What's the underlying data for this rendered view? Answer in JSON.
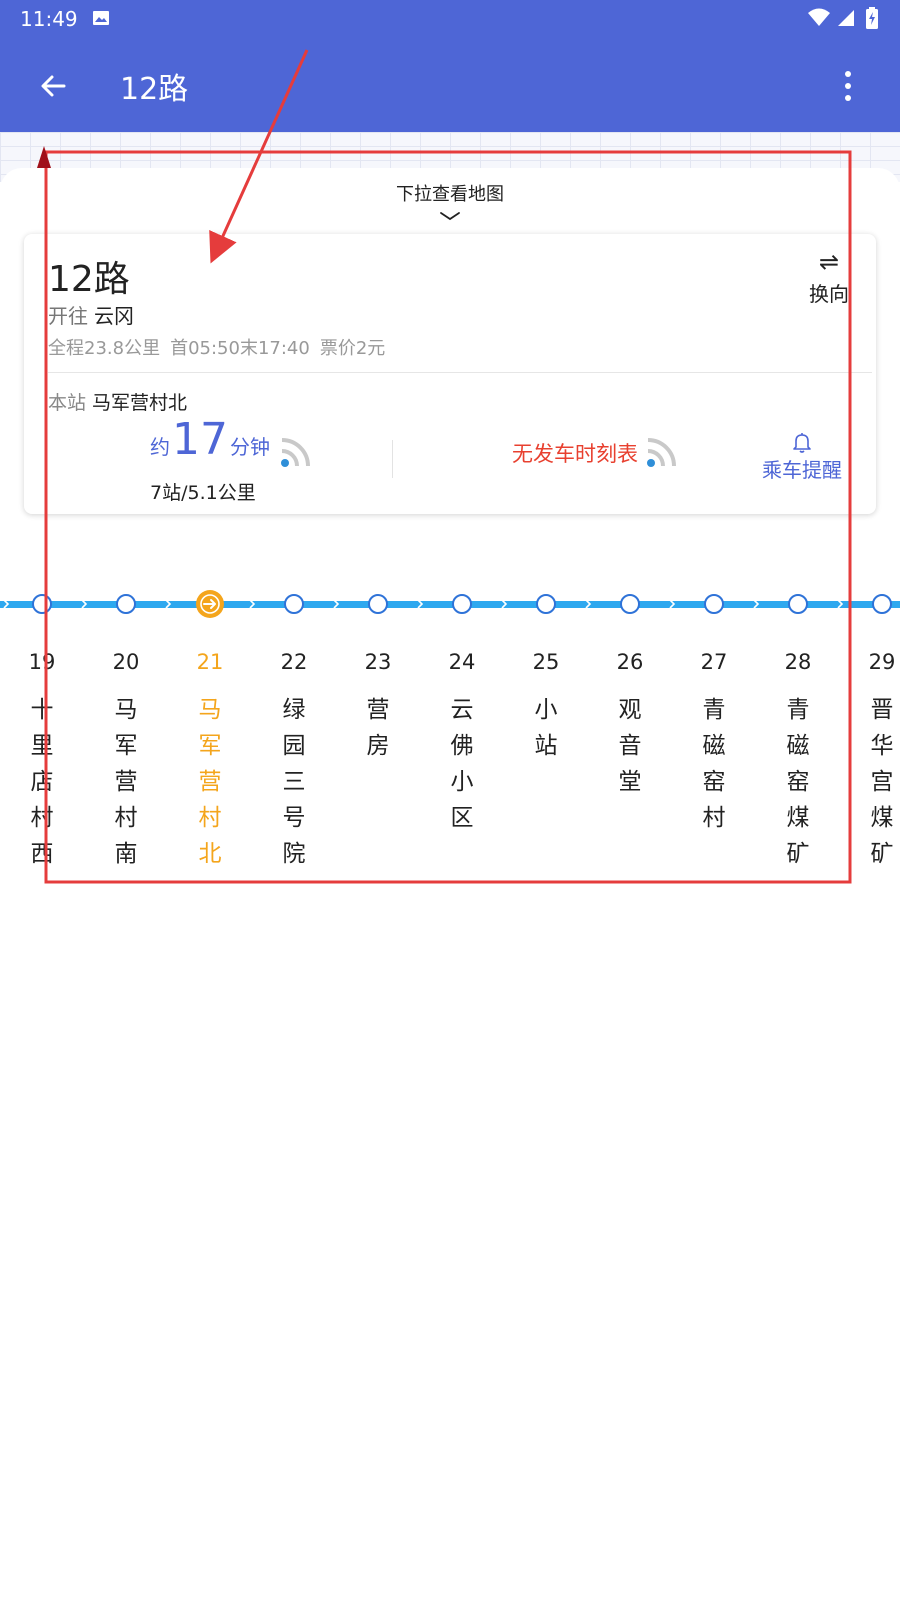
{
  "status_bar": {
    "time": "11:49"
  },
  "app_bar": {
    "title": "12路"
  },
  "map_hint": "下拉查看地图",
  "route": {
    "name": "12路",
    "direction_prefix": "开往",
    "destination": "云冈",
    "distance": "全程23.8公里",
    "hours": "首05:50末17:40",
    "fare": "票价2元",
    "switch_label": "换向",
    "switch_icon": "⇌"
  },
  "station": {
    "prefix": "本站",
    "name": "马军营村北",
    "eta_prefix": "约",
    "eta_minutes": "17",
    "eta_unit": "分钟",
    "eta_detail": "7站/5.1公里",
    "no_schedule": "无发车时刻表",
    "remind_label": "乘车提醒"
  },
  "stops": [
    {
      "num": "19",
      "name": "十里店村西"
    },
    {
      "num": "20",
      "name": "马军营村南"
    },
    {
      "num": "21",
      "name": "马军营村北",
      "current": true
    },
    {
      "num": "22",
      "name": "绿园三号院"
    },
    {
      "num": "23",
      "name": "营房"
    },
    {
      "num": "24",
      "name": "云佛小区"
    },
    {
      "num": "25",
      "name": "小站"
    },
    {
      "num": "26",
      "name": "观音堂"
    },
    {
      "num": "27",
      "name": "青磁窑村"
    },
    {
      "num": "28",
      "name": "青磁窑煤矿"
    },
    {
      "num": "29",
      "name": "晋华宫煤矿"
    }
  ],
  "colors": {
    "brand": "#4e66d6",
    "line": "#2ea8ef",
    "current": "#f4a51c",
    "alert": "#e8402f",
    "annotation": "#e53c3c"
  }
}
